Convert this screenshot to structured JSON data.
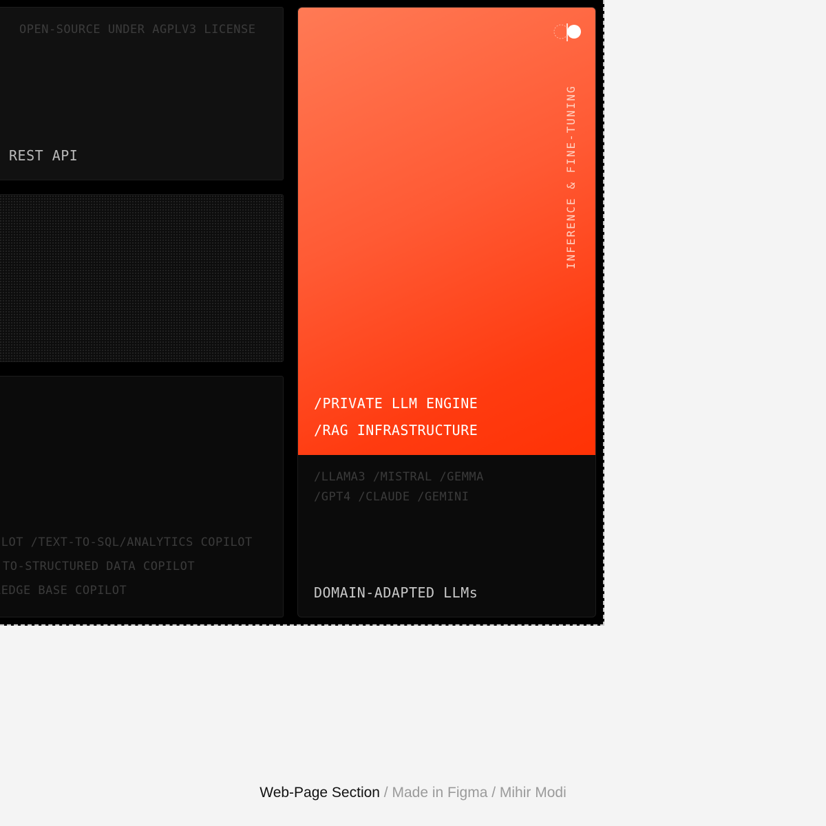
{
  "left_column": {
    "api_card": {
      "license_text": "OPEN-SOURCE UNDER AGPLV3 LICENSE",
      "label": "REST API"
    },
    "copilot_card": {
      "items": [
        "ILOT /TEXT-TO-SQL/ANALYTICS COPILOT",
        "TO-STRUCTURED DATA COPILOT",
        "LEDGE BASE COPILOT"
      ]
    }
  },
  "llm_card": {
    "vertical_label": "INFERENCE & FINE-TUNING",
    "engine_items": [
      "/PRIVATE LLM ENGINE",
      "/RAG INFRASTRUCTURE"
    ],
    "model_rows": [
      "/LLAMA3 /MISTRAL /GEMMA",
      "/GPT4 /CLAUDE /GEMINI"
    ],
    "footer_label": "DOMAIN-ADAPTED LLMs"
  },
  "credit": {
    "title": "Web-Page Section",
    "separator": " / ",
    "tool": "Made in Figma",
    "author": "Mihir Modi"
  },
  "colors": {
    "accent_start": "#ff7a55",
    "accent_end": "#ff3205",
    "frame_bg": "#000000",
    "page_bg": "#f4f4f4"
  }
}
